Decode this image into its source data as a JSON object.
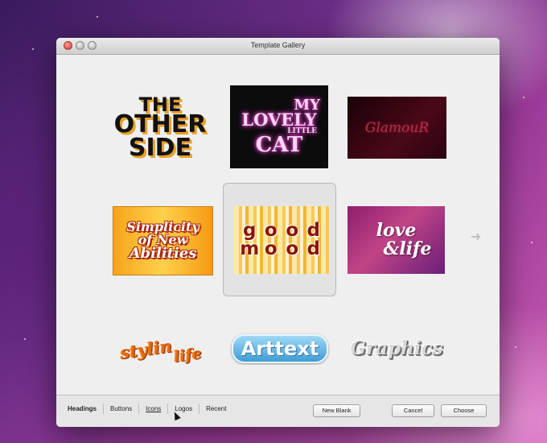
{
  "window": {
    "title": "Template Gallery"
  },
  "gallery": {
    "tiles": [
      {
        "lines": [
          "THE",
          "OTHER",
          "SIDE"
        ]
      },
      {
        "lines": [
          "MY",
          "LOVELY",
          "LITTLE",
          "CAT"
        ]
      },
      {
        "lines": [
          "GlamouR"
        ]
      },
      {
        "lines": [
          "Simplicity",
          "of New",
          "Abilities"
        ]
      },
      {
        "lines": [
          "good",
          "mood"
        ]
      },
      {
        "lines": [
          "love",
          "&life"
        ]
      },
      {
        "lines": [
          "stylin",
          "life"
        ]
      },
      {
        "lines": [
          "Arttext"
        ]
      },
      {
        "lines": [
          "Graphics"
        ]
      }
    ],
    "selected_index": 4,
    "next_icon": "arrow-right-icon"
  },
  "tabs": [
    {
      "label": "Headings",
      "active": true
    },
    {
      "label": "Buttons",
      "active": false
    },
    {
      "label": "Icons",
      "active": false
    },
    {
      "label": "Logos",
      "active": false
    },
    {
      "label": "Recent",
      "active": false
    }
  ],
  "buttons": {
    "new_blank": "New Blank",
    "cancel": "Cancel",
    "choose": "Choose"
  }
}
